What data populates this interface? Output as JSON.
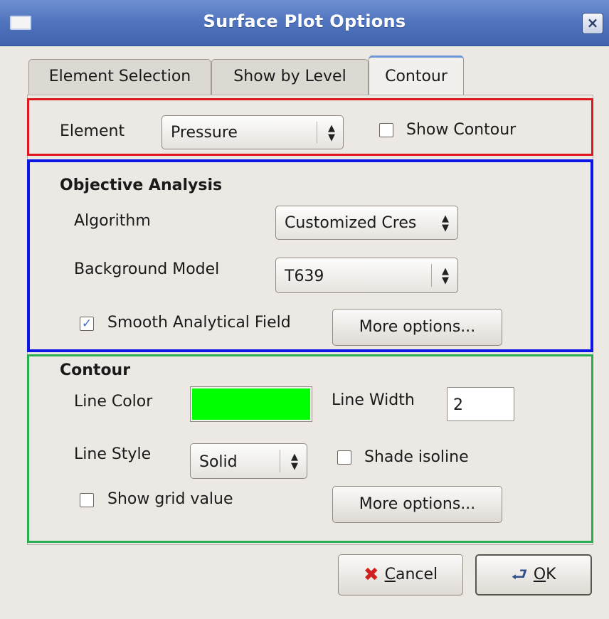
{
  "window": {
    "title": "Surface Plot Options",
    "close_glyph": "×",
    "icon": "window-icon"
  },
  "tabs": [
    {
      "label": "Element Selection",
      "active": false
    },
    {
      "label": "Show by Level",
      "active": false
    },
    {
      "label": "Contour",
      "active": true
    }
  ],
  "element_row": {
    "label": "Element",
    "combo_value": "Pressure",
    "show_contour_label": "Show Contour",
    "show_contour_checked": false
  },
  "objective_analysis": {
    "heading": "Objective Analysis",
    "algorithm_label": "Algorithm",
    "algorithm_value": "Customized Cres",
    "background_label": "Background Model",
    "background_value": "T639",
    "smooth_label": "Smooth Analytical Field",
    "smooth_checked": true,
    "more_options": "More options..."
  },
  "contour": {
    "heading": "Contour",
    "line_color_label": "Line Color",
    "line_color": "#00ff00",
    "line_width_label": "Line Width",
    "line_width_value": "2",
    "line_style_label": "Line Style",
    "line_style_value": "Solid",
    "shade_label": "Shade isoline",
    "shade_checked": false,
    "grid_label": "Show grid value",
    "grid_checked": false,
    "more_options": "More options..."
  },
  "buttons": {
    "cancel_mnemonic": "C",
    "cancel_rest": "ancel",
    "ok_mnemonic": "O",
    "ok_rest": "K"
  },
  "colors": {
    "highlight_red": "#e0151d",
    "highlight_blue": "#0d16e6",
    "highlight_green": "#28b050",
    "titlebar": "#4f73bd"
  }
}
